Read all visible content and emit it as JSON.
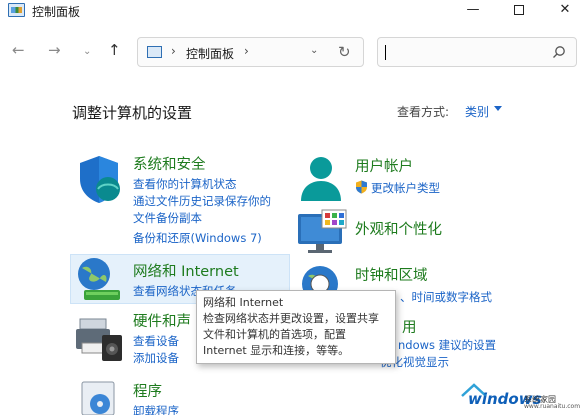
{
  "window": {
    "title": "控制面板",
    "min_glyph": "—",
    "close_glyph": "✕"
  },
  "nav": {
    "back_glyph": "←",
    "forward_glyph": "→",
    "recent_glyph": "⌄",
    "up_glyph": "↑",
    "address_sep": "›",
    "address_text": "控制面板",
    "address_dropdown": "⌄",
    "refresh_glyph": "↻",
    "search_value": ""
  },
  "header": {
    "title": "调整计算机的设置",
    "view_by_label": "查看方式:",
    "view_by_value": "类别"
  },
  "categories": {
    "system": {
      "title": "系统和安全",
      "links": [
        "查看你的计算机状态",
        "通过文件历史记录保存你的",
        "文件备份副本",
        "备份和还原(Windows 7)"
      ]
    },
    "network": {
      "title": "网络和 Internet",
      "links": [
        "查看网络状态和任务"
      ]
    },
    "hardware": {
      "title": "硬件和声",
      "links": [
        "查看设备",
        "添加设备"
      ]
    },
    "programs": {
      "title": "程序",
      "links": [
        "卸载程序"
      ]
    },
    "user": {
      "title": "用户帐户",
      "links": [
        "更改帐户类型"
      ]
    },
    "appearance": {
      "title": "外观和个性化"
    },
    "clock": {
      "title": "时钟和区域",
      "links": [
        "、时间或数字格式"
      ]
    },
    "access": {
      "title": "用",
      "links": [
        "ndows 建议的设置",
        "优化视觉显示"
      ]
    }
  },
  "tooltip": {
    "lines": [
      "网络和 Internet",
      "检查网络状态并更改设置，设置共享",
      "文件和计算机的首选项，配置",
      "Internet 显示和连接，等等。"
    ]
  },
  "watermark": {
    "brand": "windows",
    "sub": "系统家园",
    "url": "www.ruanaitu.com"
  },
  "colors": {
    "category_green": "#1e7b1e",
    "link_blue": "#1b64c7",
    "hover_bg": "#e5f1fb"
  }
}
